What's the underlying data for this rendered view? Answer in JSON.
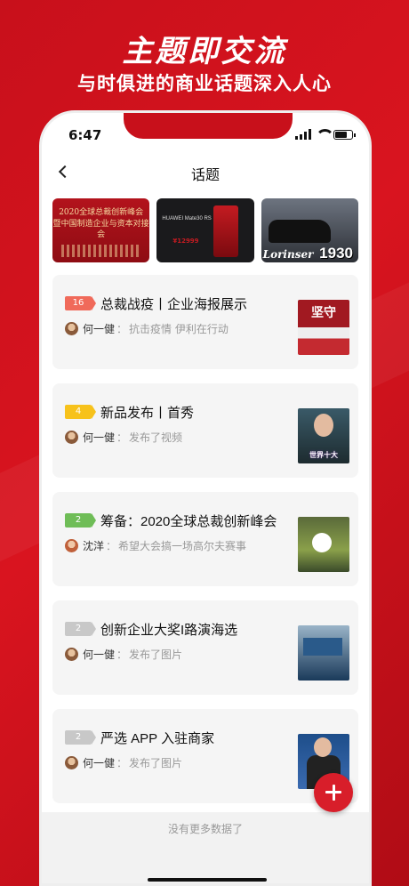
{
  "hero": {
    "title": "主题即交流",
    "subtitle": "与时俱进的商业话题深入人心"
  },
  "status_bar": {
    "time": "6:47"
  },
  "nav": {
    "title": "话题",
    "back_icon": "chevron-left-icon"
  },
  "banners": [
    {
      "lines": [
        "2020全球总裁创新峰会",
        "暨中国制造企业与资本对接会"
      ]
    },
    {
      "brand": "HUAWEI Mate30 RS",
      "price": "¥12999"
    },
    {
      "brand": "Lorinser",
      "number": "1930"
    }
  ],
  "topics": [
    {
      "count": "16",
      "color": "#f06a5a",
      "title": "总裁战疫丨企业海报展示",
      "author": "何一健",
      "desc": "抗击疫情 伊利在行动",
      "thumb_text": "坚守"
    },
    {
      "count": "4",
      "color": "#f7c21b",
      "title": "新品发布丨首秀",
      "author": "何一健",
      "desc": "发布了视频",
      "thumb_text": "世界十大"
    },
    {
      "count": "2",
      "color": "#6fbd57",
      "title": "筹备：2020全球总裁创新峰会",
      "author": "沈洋",
      "desc": "希望大会搞一场高尔夫赛事"
    },
    {
      "count": "2",
      "color": "#c8c8c8",
      "title": "创新企业大奖I路演海选",
      "author": "何一健",
      "desc": "发布了图片"
    },
    {
      "count": "2",
      "color": "#c8c8c8",
      "title": "严选 APP 入驻商家",
      "author": "何一健",
      "desc": "发布了图片"
    }
  ],
  "footer": {
    "text": "没有更多数据了"
  },
  "fab": {
    "icon": "plus-icon"
  }
}
